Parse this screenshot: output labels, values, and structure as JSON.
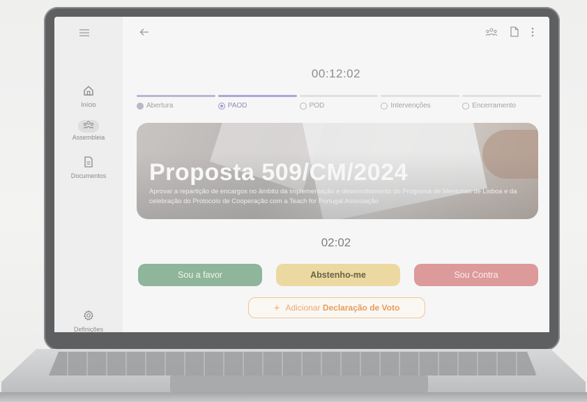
{
  "sidebar": {
    "items": [
      {
        "label": "Início",
        "icon": "home-icon"
      },
      {
        "label": "Assembleia",
        "icon": "people-icon"
      },
      {
        "label": "Documentos",
        "icon": "document-icon"
      }
    ],
    "settings_label": "Definições",
    "menu_icon": "menu-icon",
    "settings_icon": "gear-icon"
  },
  "header": {
    "back_icon": "arrow-left-icon",
    "icons": [
      "people-icon",
      "file-icon",
      "more-vertical-icon"
    ],
    "timer": "00:12:02"
  },
  "steps": [
    {
      "label": "Abertura",
      "state": "done"
    },
    {
      "label": "PAOD",
      "state": "active"
    },
    {
      "label": "POD",
      "state": "pending"
    },
    {
      "label": "Intervenções",
      "state": "pending"
    },
    {
      "label": "Encerramento",
      "state": "pending"
    }
  ],
  "proposal": {
    "title": "Proposta 509/CM/2024",
    "description": "Aprovar a repartição de encargos no âmbito da implementação e desenvolvimento do Programa de Mentorias de Lisboa e da celebração do Protocolo de Cooperação com a Teach for Portugal Associação"
  },
  "vote": {
    "timer": "02:02",
    "favor_label": "Sou a favor",
    "abstain_label": "Abstenho-me",
    "against_label": "Sou Contra",
    "declaration_prefix": "Adicionar",
    "declaration_label": "Declaração de Voto"
  },
  "colors": {
    "favor": "#8fb59a",
    "abstain": "#ecd9a2",
    "against": "#dc9a9b",
    "accent": "#aaa7d8",
    "declaration": "#e59d5f"
  }
}
